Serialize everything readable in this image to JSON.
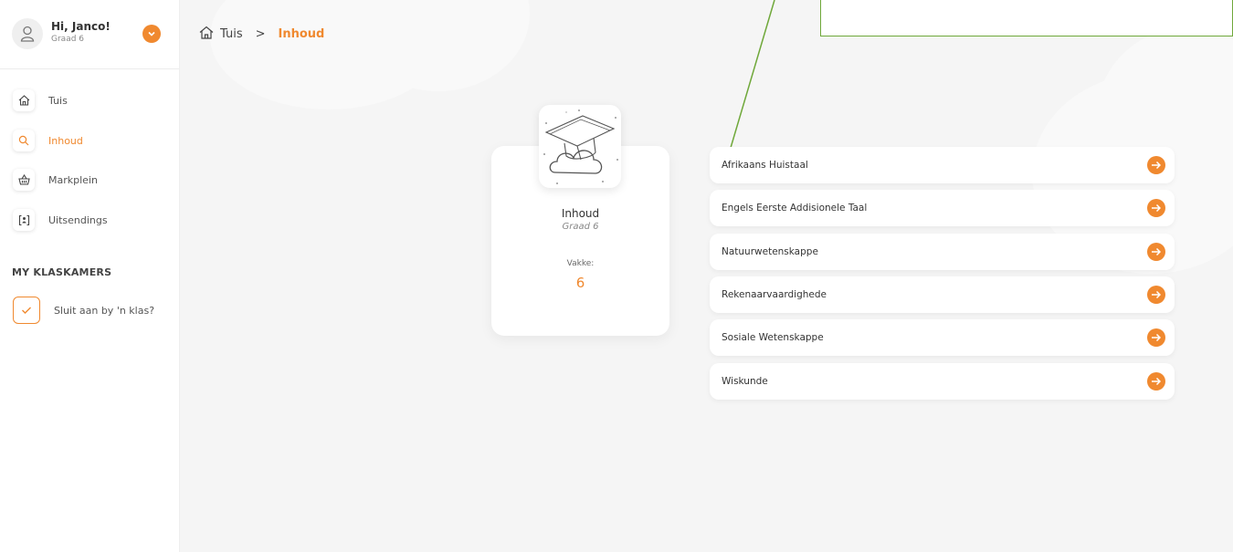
{
  "user": {
    "greeting": "Hi, Janco!",
    "grade": "Graad 6",
    "icons": {
      "avatar": "user-outline-icon",
      "toggle": "chevron-down-icon"
    }
  },
  "nav": {
    "items": [
      {
        "label": "Tuis",
        "icon": "home-icon",
        "active": false
      },
      {
        "label": "Inhoud",
        "icon": "search-icon",
        "active": true
      },
      {
        "label": "Markplein",
        "icon": "basket-icon",
        "active": false
      },
      {
        "label": "Uitsendings",
        "icon": "broadcast-icon",
        "active": false
      }
    ]
  },
  "classrooms": {
    "title": "MY KLASKAMERS",
    "join_label": "Sluit aan by 'n klas?",
    "join_icon": "check-icon"
  },
  "breadcrumb": {
    "home": "Tuis",
    "separator": ">",
    "current": "Inhoud",
    "home_icon": "home-icon"
  },
  "info_card": {
    "title": "Inhoud",
    "grade": "Graad 6",
    "subjects_label": "Vakke:",
    "subjects_count": "6",
    "image_icon": "graduation-cloud-icon"
  },
  "subjects": [
    {
      "name": "Afrikaans Huistaal"
    },
    {
      "name": "Engels Eerste Addisionele Taal"
    },
    {
      "name": "Natuurwetenskappe"
    },
    {
      "name": "Rekenaarvaardighede"
    },
    {
      "name": "Sosiale Wetenskappe"
    },
    {
      "name": "Wiskunde"
    }
  ],
  "colors": {
    "accent": "#f0892f",
    "annotation": "#6fa83a",
    "background": "#f5f5f5",
    "card": "#ffffff"
  }
}
